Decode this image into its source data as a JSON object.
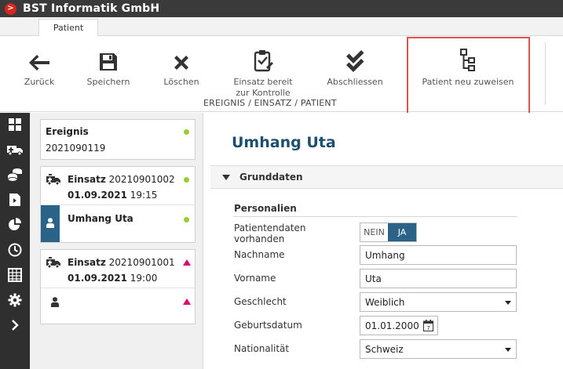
{
  "app": {
    "title": "BST Informatik GmbH",
    "logo_glyph": ">"
  },
  "tabs": [
    {
      "label": "Patient"
    }
  ],
  "ribbon": {
    "buttons": [
      {
        "label": "Zurück",
        "icon": "arrow-left-icon"
      },
      {
        "label": "Speichern",
        "icon": "floppy-disk-icon"
      },
      {
        "label": "Löschen",
        "icon": "close-x-icon"
      },
      {
        "label_line1": "Einsatz bereit",
        "label_line2": "zur Kontrolle",
        "icon": "clipboard-edit-icon"
      },
      {
        "label": "Abschliessen",
        "icon": "double-check-icon"
      },
      {
        "label": "Patient neu zuweisen",
        "icon": "hierarchy-tree-icon"
      }
    ],
    "group_label": "EREIGNIS / EINSATZ / PATIENT"
  },
  "colors": {
    "accent": "#2a6288",
    "heading": "#1f4f6f",
    "status_ok": "#9acd32",
    "status_alert": "#e0006a",
    "highlight": "#e0524f",
    "nav_bg": "#2f2f2f"
  },
  "nav": {
    "items": [
      {
        "icon": "grid-icon"
      },
      {
        "icon": "ambulance-icon"
      },
      {
        "icon": "coins-stack-icon"
      },
      {
        "icon": "document-export-icon"
      },
      {
        "icon": "pie-chart-icon"
      },
      {
        "icon": "clock-icon"
      },
      {
        "icon": "calendar-grid-icon"
      },
      {
        "icon": "gear-icon"
      },
      {
        "icon": "chevron-right-icon"
      }
    ]
  },
  "tree": {
    "ereignis": {
      "label": "Ereignis",
      "number": "2021090119",
      "status": "ok"
    },
    "einsatz1": {
      "prefix": "Einsatz",
      "number": "20210901002",
      "date": "01.09.2021",
      "time": "19:15",
      "status": "ok"
    },
    "patient1": {
      "name": "Umhang Uta",
      "status": "ok"
    },
    "einsatz2": {
      "prefix": "Einsatz",
      "number": "20210901001",
      "date": "01.09.2021",
      "time": "19:00",
      "status": "alert"
    },
    "patient2": {
      "name": "",
      "status": "alert"
    }
  },
  "main": {
    "heading": "Umhang Uta",
    "section": "Grunddaten",
    "subsection": "Personalien",
    "fields": {
      "patientendaten_label_line1": "Patientendaten",
      "patientendaten_label_line2": "vorhanden",
      "toggle_no": "NEIN",
      "toggle_yes": "JA",
      "toggle_value": "JA",
      "nachname_label": "Nachname",
      "nachname_value": "Umhang",
      "vorname_label": "Vorname",
      "vorname_value": "Uta",
      "geschlecht_label": "Geschlecht",
      "geschlecht_value": "Weiblich",
      "geburtsdatum_label": "Geburtsdatum",
      "geburtsdatum_value": "01.01.2000",
      "calendar_day": "7",
      "nationalitaet_label": "Nationalität",
      "nationalitaet_value": "Schweiz"
    }
  }
}
